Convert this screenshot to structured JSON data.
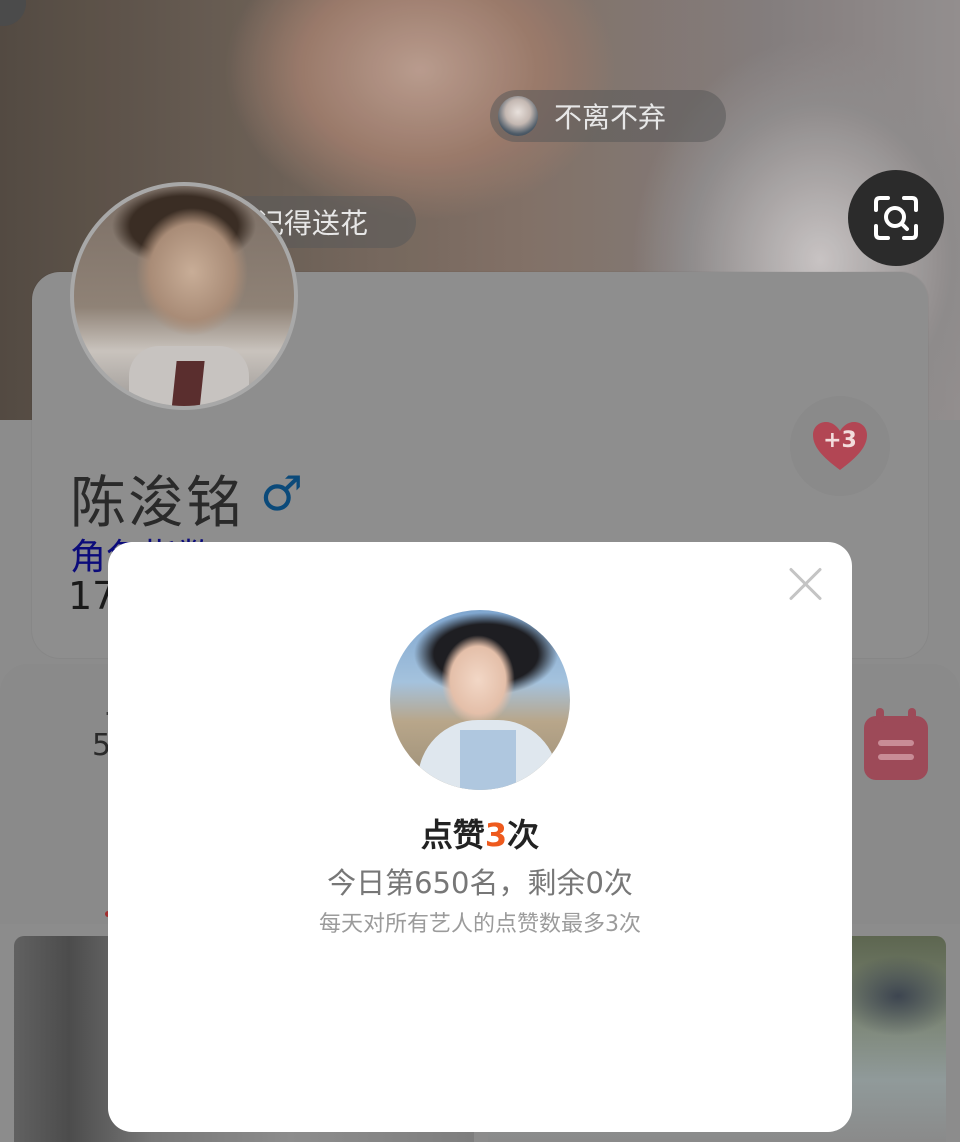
{
  "background": {
    "status_pill": "不离不弃",
    "flower_pill": "记得送花"
  },
  "profile": {
    "name": "陈浚铭",
    "gender_symbol": "♂",
    "role_index_label": "角色指数：5",
    "count_line": "17",
    "like_bonus": "+3",
    "stat_dot": "·",
    "stat_value": "5"
  },
  "modal": {
    "title_prefix": "点赞",
    "title_count": "3",
    "title_suffix": "次",
    "rank_text": "今日第650名，剩余0次",
    "rule_text": "每天对所有艺人的点赞数最多3次"
  },
  "colors": {
    "accent_orange": "#ee5a1d",
    "heart_red": "#e84b5f",
    "gender_blue": "#0b4a7a",
    "role_blue": "#0b0b7a"
  },
  "icons": [
    "scan-icon",
    "heart-icon",
    "male-gender-icon",
    "calendar-icon",
    "close-icon"
  ]
}
